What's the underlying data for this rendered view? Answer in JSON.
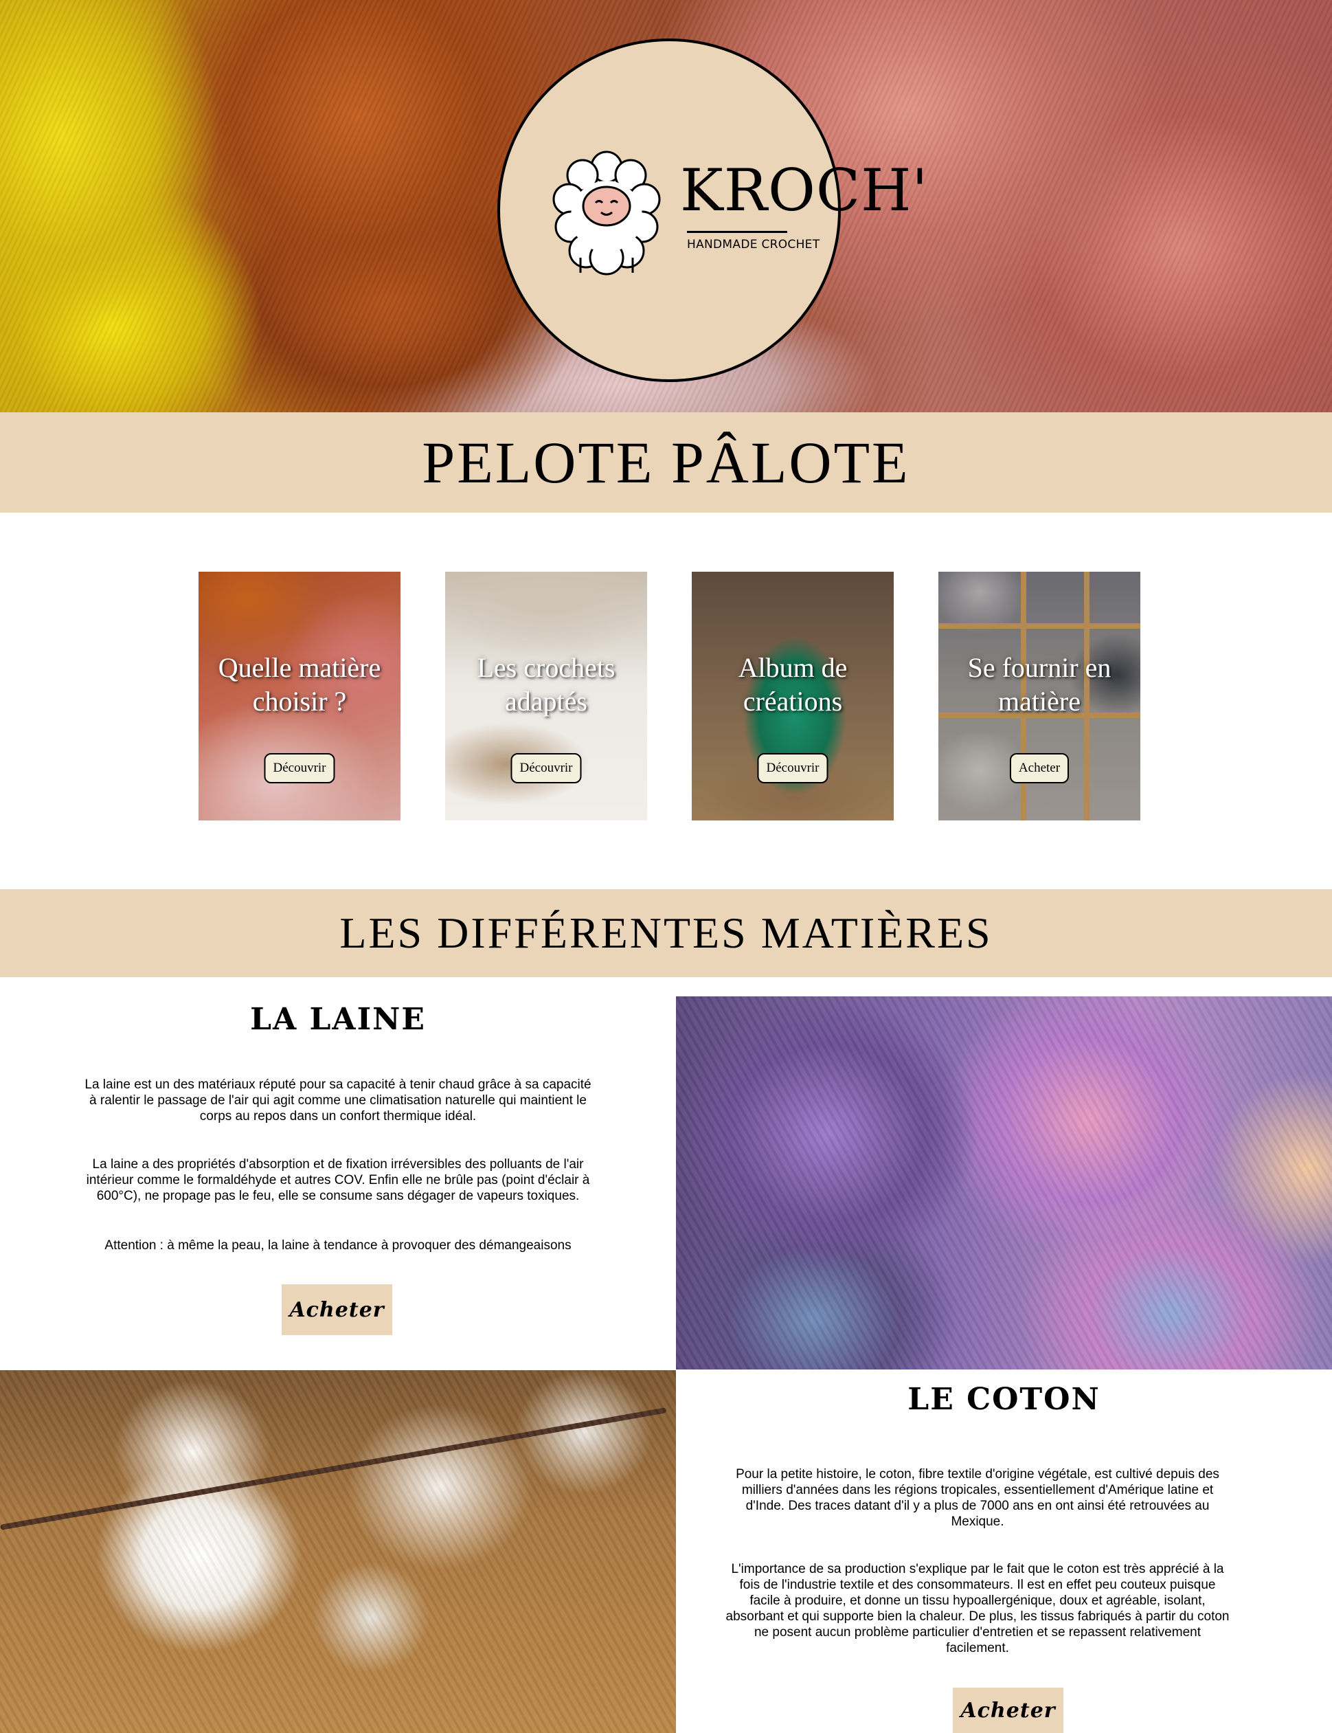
{
  "header": {
    "brand_name": "KROCH'",
    "brand_tagline": "HANDMADE CROCHET"
  },
  "hero_title": "PELOTE PÂLOTE",
  "cards": [
    {
      "title_line1": "Quelle matière",
      "title_line2": "choisir ?",
      "button": "Découvrir"
    },
    {
      "title_line1": "Les crochets",
      "title_line2": "adaptés",
      "button": "Découvrir"
    },
    {
      "title_line1": "Album de",
      "title_line2": "créations",
      "button": "Découvrir"
    },
    {
      "title_line1": "Se fournir en",
      "title_line2": "matière",
      "button": "Acheter"
    }
  ],
  "materials_title": "LES DIFFÉRENTES MATIÈRES",
  "laine": {
    "title": "LA LAINE",
    "p1": "La laine est un des matériaux réputé pour sa capacité à tenir chaud grâce à sa capacité à ralentir le passage de l'air qui agit comme une climatisation naturelle qui maintient le corps au repos dans un confort thermique idéal.",
    "p2": "La laine a des propriétés d'absorption et de fixation irréversibles des polluants de l'air intérieur comme le formaldéhyde et autres COV. Enfin elle ne brûle pas (point d'éclair à 600°C), ne propage pas le feu, elle se consume sans dégager de vapeurs toxiques.",
    "p3": "Attention : à même la peau, la laine à tendance à provoquer des démangeaisons",
    "button": "Acheter"
  },
  "coton": {
    "title": "LE COTON",
    "p1": "Pour la petite histoire, le coton, fibre textile d'origine végétale, est cultivé depuis des milliers d'années dans les régions tropicales, essentiellement d'Amérique latine et d'Inde. Des traces datant d'il y a plus de 7000 ans en ont ainsi été retrouvées au Mexique.",
    "p2": "L'importance de sa production s'explique par le fait que le coton est très apprécié à la fois de l'industrie textile et des consommateurs. Il est en effet peu couteux puisque facile à produire, et donne un tissu hypoallergénique, doux et agréable, isolant, absorbant et qui supporte bien la chaleur. De plus, les tissus fabriqués à partir du coton ne posent aucun problème particulier d'entretien et se repassent relativement facilement.",
    "button": "Acheter"
  },
  "colors": {
    "beige": "#ebd5b9",
    "button_cream": "#f5f0dc"
  }
}
